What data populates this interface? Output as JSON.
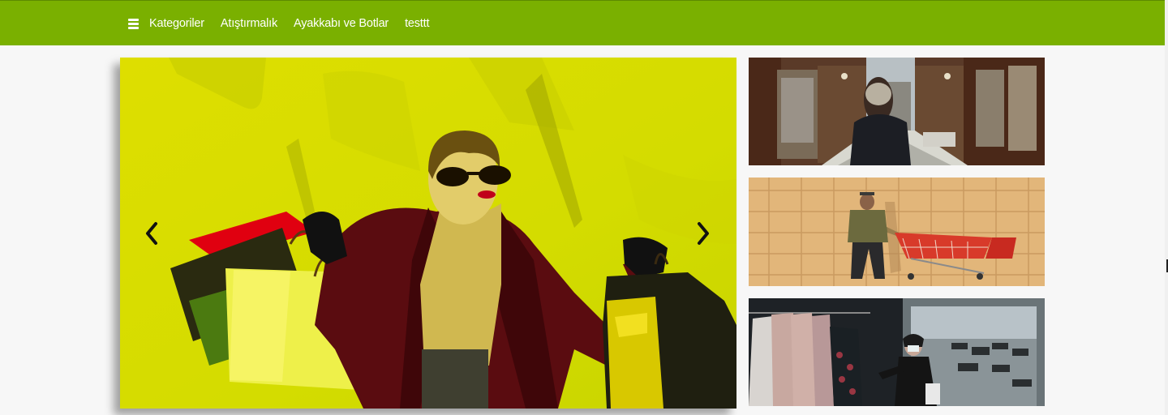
{
  "nav": {
    "menu_icon": "hamburger-icon",
    "items": [
      {
        "label": "Kategoriler"
      },
      {
        "label": "Atıştırmalık"
      },
      {
        "label": "Ayakkabı ve Botlar"
      },
      {
        "label": "testtt"
      }
    ]
  },
  "colors": {
    "brand_green": "#7ab000",
    "slide_background": "#d8e000"
  },
  "slider": {
    "prev_icon": "chevron-left-icon",
    "next_icon": "chevron-right-icon"
  }
}
